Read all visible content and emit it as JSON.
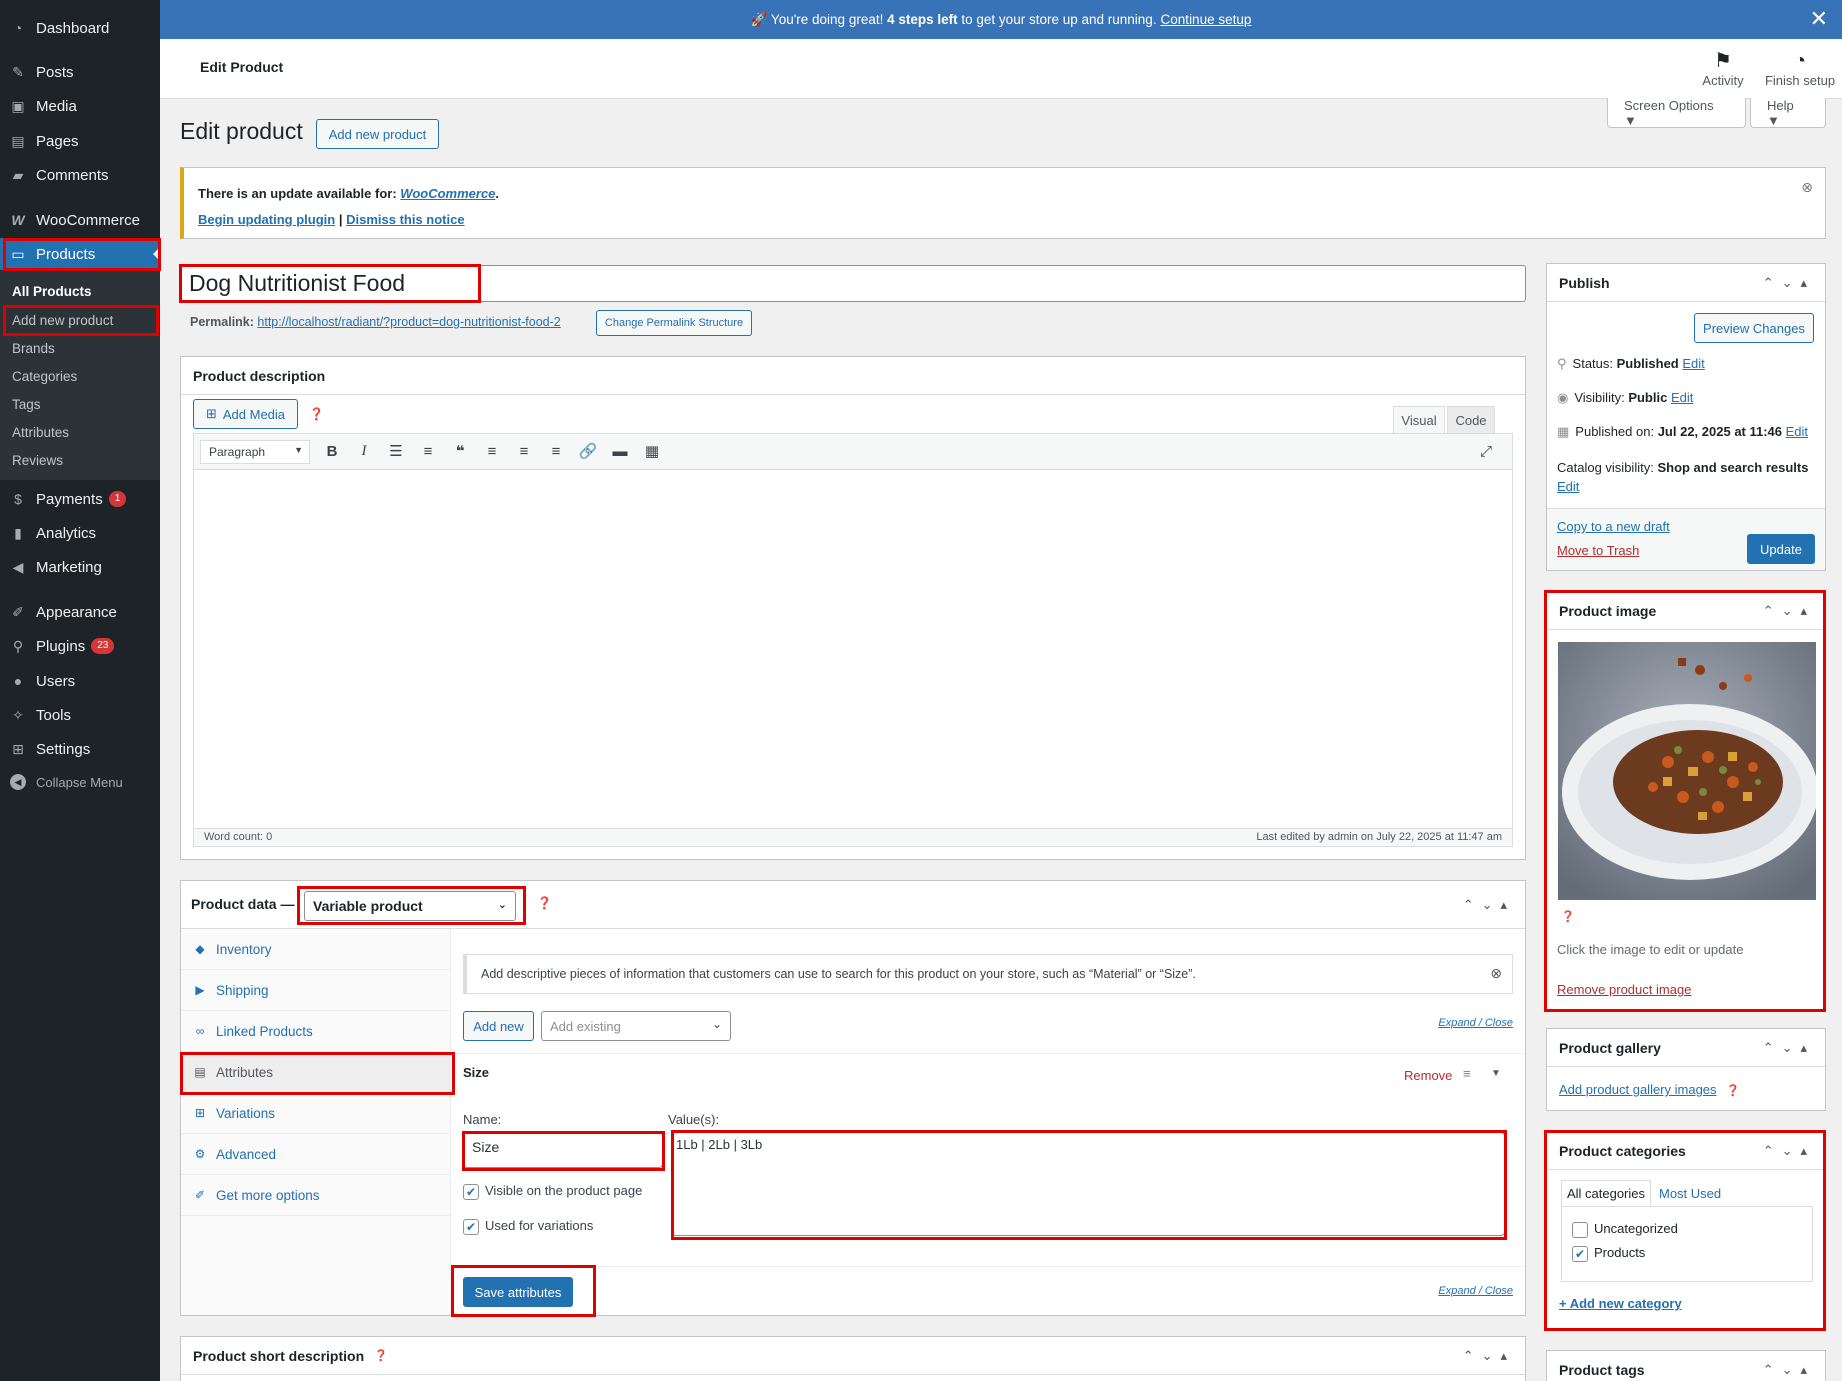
{
  "sidebar": {
    "dashboard": "Dashboard",
    "posts": "Posts",
    "media": "Media",
    "pages": "Pages",
    "comments": "Comments",
    "woocommerce": "WooCommerce",
    "products": "Products",
    "submenu": {
      "all_products": "All Products",
      "add_new": "Add new product",
      "brands": "Brands",
      "categories": "Categories",
      "tags": "Tags",
      "attributes": "Attributes",
      "reviews": "Reviews"
    },
    "payments": "Payments",
    "payments_badge": "1",
    "analytics": "Analytics",
    "marketing": "Marketing",
    "appearance": "Appearance",
    "plugins": "Plugins",
    "plugins_badge": "23",
    "users": "Users",
    "tools": "Tools",
    "settings": "Settings",
    "collapse": "Collapse Menu"
  },
  "banner": {
    "prefix": "🚀 You're doing great!",
    "bold": "4 steps left",
    "suffix": "to get your store up and running.",
    "link": "Continue setup"
  },
  "header": {
    "title": "Edit Product",
    "activity": "Activity",
    "finish_setup": "Finish setup",
    "screen_options": "Screen Options ▼",
    "help": "Help ▼"
  },
  "page": {
    "heading": "Edit product",
    "add_new_button": "Add new product"
  },
  "notice": {
    "text": "There is an update available for:",
    "plugin": "WooCommerce",
    "begin_update": "Begin updating plugin",
    "separator": "|",
    "dismiss": "Dismiss this notice"
  },
  "product": {
    "title": "Dog Nutritionist Food",
    "permalink_label": "Permalink:",
    "permalink_url": "http://localhost/radiant/?product=dog-nutritionist-food-2",
    "change_permalink": "Change Permalink Structure"
  },
  "description": {
    "heading": "Product description",
    "add_media": "Add Media",
    "tab_visual": "Visual",
    "tab_code": "Code",
    "format": "Paragraph",
    "word_count": "Word count: 0",
    "last_edited": "Last edited by admin on July 22, 2025 at 11:47 am"
  },
  "product_data": {
    "label": "Product data —",
    "type": "Variable product",
    "tabs": [
      "Inventory",
      "Shipping",
      "Linked Products",
      "Attributes",
      "Variations",
      "Advanced",
      "Get more options"
    ],
    "info": "Add descriptive pieces of information that customers can use to search for this product on your store, such as “Material” or “Size”.",
    "add_new": "Add new",
    "add_existing": "Add existing",
    "expand_close": "Expand / Close",
    "attribute_title": "Size",
    "remove": "Remove",
    "name_label": "Name:",
    "values_label": "Value(s):",
    "name_value": "Size",
    "values_value": "1Lb | 2Lb | 3Lb",
    "visible": "Visible on the product page",
    "used_for_variations": "Used for variations",
    "save": "Save attributes"
  },
  "short_description": {
    "heading": "Product short description"
  },
  "publish": {
    "heading": "Publish",
    "preview": "Preview Changes",
    "status_label": "Status:",
    "status_value": "Published",
    "visibility_label": "Visibility:",
    "visibility_value": "Public",
    "published_label": "Published on:",
    "published_value": "Jul 22, 2025 at 11:46",
    "catalog_label": "Catalog visibility:",
    "catalog_value": "Shop and search results",
    "edit": "Edit",
    "copy_draft": "Copy to a new draft",
    "trash": "Move to Trash",
    "update": "Update"
  },
  "product_image": {
    "heading": "Product image",
    "hint": "Click the image to edit or update",
    "remove": "Remove product image"
  },
  "gallery": {
    "heading": "Product gallery",
    "add": "Add product gallery images"
  },
  "categories": {
    "heading": "Product categories",
    "tab_all": "All categories",
    "tab_used": "Most Used",
    "items": [
      "Uncategorized",
      "Products"
    ],
    "add_new": "+ Add new category"
  },
  "tags": {
    "heading": "Product tags"
  }
}
